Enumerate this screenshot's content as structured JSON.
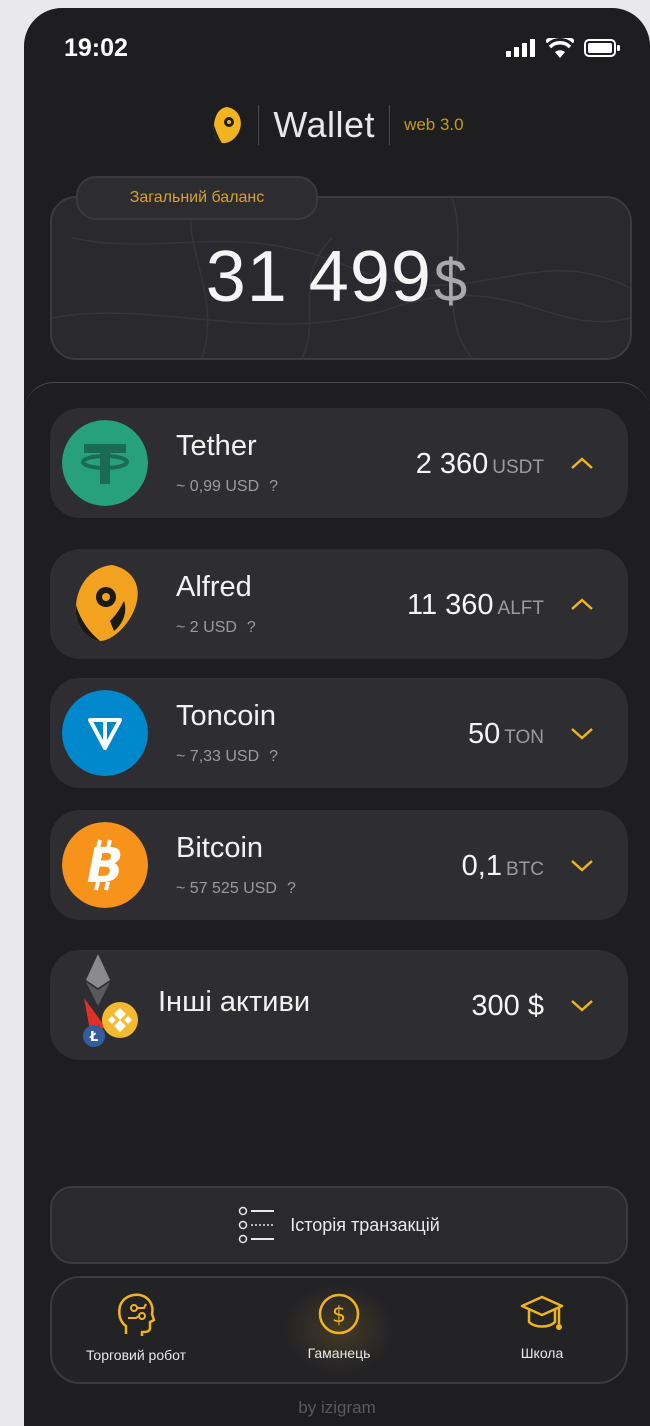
{
  "status_bar": {
    "time": "19:02"
  },
  "header": {
    "title": "Wallet",
    "version": "web 3.0"
  },
  "balance": {
    "label": "Загальний баланс",
    "amount": "31 499",
    "currency": "$"
  },
  "assets": [
    {
      "name": "Tether",
      "rate": "~ 0,99 USD",
      "help": "?",
      "amount": "2 360",
      "unit": "USDT",
      "icon": "tether-icon",
      "color": "#26a17b",
      "expanded": true
    },
    {
      "name": "Alfred",
      "rate": "~ 2 USD",
      "help": "?",
      "amount": "11 360",
      "unit": "ALFT",
      "icon": "alfred-icon",
      "color": "#f5a623",
      "expanded": true
    },
    {
      "name": "Toncoin",
      "rate": "~ 7,33 USD",
      "help": "?",
      "amount": "50",
      "unit": "TON",
      "icon": "toncoin-icon",
      "color": "#0088cc",
      "expanded": false
    },
    {
      "name": "Bitcoin",
      "rate": "~ 57 525 USD",
      "help": "?",
      "amount": "0,1",
      "unit": "BTC",
      "icon": "bitcoin-icon",
      "color": "#f7931a",
      "expanded": false
    }
  ],
  "other_assets": {
    "label": "Інші активи",
    "amount": "300 $"
  },
  "history": {
    "label": "Історія транзакцій"
  },
  "nav": {
    "items": [
      {
        "label": "Торговий робот",
        "icon": "robot-head-icon"
      },
      {
        "label": "Гаманець",
        "icon": "dollar-coin-icon",
        "active": true
      },
      {
        "label": "Школа",
        "icon": "graduation-cap-icon"
      }
    ]
  },
  "footer": {
    "text": "by izigram"
  },
  "colors": {
    "accent": "#f2b41e",
    "background": "#1e1e20",
    "card": "#2e2e32"
  }
}
